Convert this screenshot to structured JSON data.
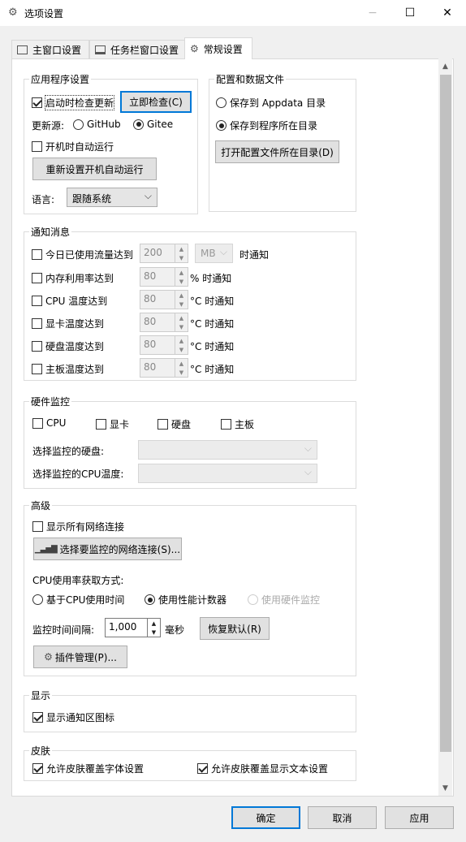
{
  "window": {
    "title": "选项设置",
    "icon": "gear-icon"
  },
  "tabs": [
    {
      "label": "主窗口设置",
      "icon": "window-icon"
    },
    {
      "label": "任务栏窗口设置",
      "icon": "taskbar-icon"
    },
    {
      "label": "常规设置",
      "icon": "gear-icon"
    }
  ],
  "app": {
    "title": "应用程序设置",
    "check_on_start": "启动时检查更新",
    "check_now": "立即检查(C)",
    "source_label": "更新源:",
    "source_github": "GitHub",
    "source_gitee": "Gitee",
    "autorun": "开机时自动运行",
    "reset_autorun": "重新设置开机自动运行",
    "language_label": "语言:",
    "language_value": "跟随系统"
  },
  "config": {
    "title": "配置和数据文件",
    "save_appdata": "保存到 Appdata 目录",
    "save_program": "保存到程序所在目录",
    "open_dir": "打开配置文件所在目录(D)"
  },
  "notify": {
    "title": "通知消息",
    "traffic": "今日已使用流量达到",
    "traffic_value": "200",
    "traffic_unit": "MB",
    "traffic_suffix": "时通知",
    "memory": "内存利用率达到",
    "memory_value": "80",
    "memory_suffix": "% 时通知",
    "cpu_temp": "CPU 温度达到",
    "cpu_value": "80",
    "gpu_temp": "显卡温度达到",
    "gpu_value": "80",
    "hdd_temp": "硬盘温度达到",
    "hdd_value": "80",
    "mb_temp": "主板温度达到",
    "mb_value": "80",
    "temp_suffix": "°C 时通知"
  },
  "hardware": {
    "title": "硬件监控",
    "cpu": "CPU",
    "gpu": "显卡",
    "hdd": "硬盘",
    "mainboard": "主板",
    "select_disk": "选择监控的硬盘:",
    "select_cpu_temp": "选择监控的CPU温度:"
  },
  "advanced": {
    "title": "高级",
    "show_all_net": "显示所有网络连接",
    "select_net": "选择要监控的网络连接(S)...",
    "cpu_method_label": "CPU使用率获取方式:",
    "cpu_time": "基于CPU使用时间",
    "perf_counter": "使用性能计数器",
    "hw_monitor": "使用硬件监控",
    "interval_label": "监控时间间隔:",
    "interval_value": "1,000",
    "interval_unit": "毫秒",
    "restore_default": "恢复默认(R)",
    "plugin_manage": "插件管理(P)..."
  },
  "display": {
    "title": "显示",
    "show_tray_icon": "显示通知区图标"
  },
  "skin": {
    "title": "皮肤",
    "allow_font": "允许皮肤覆盖字体设置",
    "allow_text": "允许皮肤覆盖显示文本设置"
  },
  "footer": {
    "ok": "确定",
    "cancel": "取消",
    "apply": "应用"
  },
  "colors": {
    "accent": "#0078d7"
  }
}
